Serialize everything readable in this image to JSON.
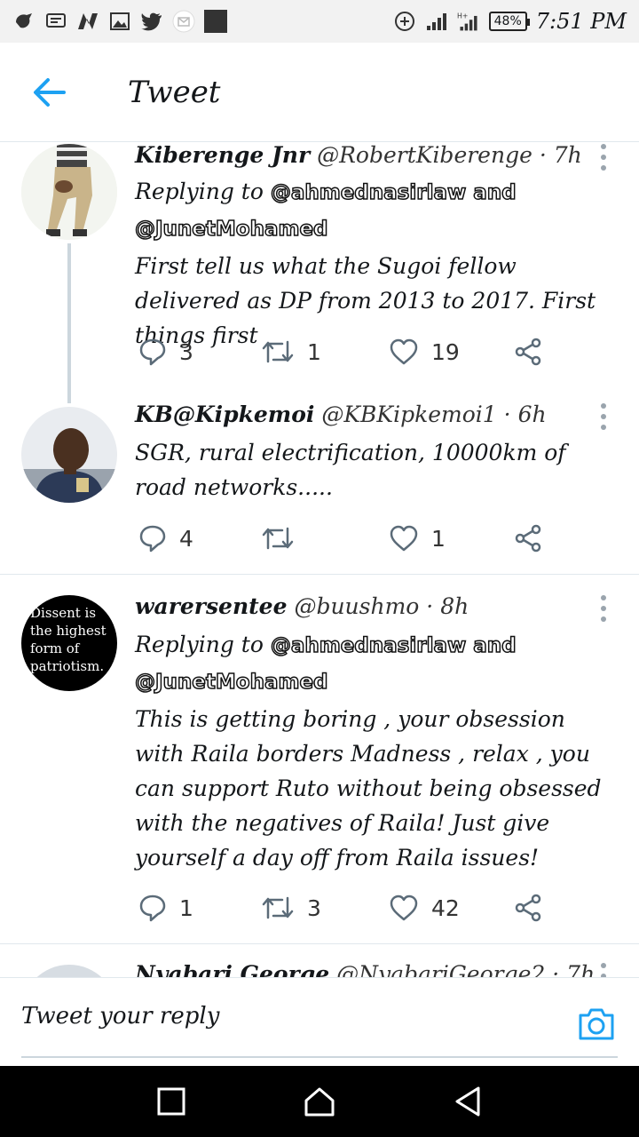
{
  "status_bar": {
    "battery": "48%",
    "time": "7:51 PM",
    "network": "H+"
  },
  "header": {
    "title": "Tweet"
  },
  "tweets": [
    {
      "name": "Kiberenge Jnr",
      "handle": "@RobertKiberenge",
      "time": "7h",
      "replying_label": "Replying to",
      "replying_to": "@ahmednasirlaw and @JunetMohamed",
      "text": "First tell us what the Sugoi fellow delivered as DP from 2013 to 2017. First things first",
      "replies": "3",
      "retweets": "1",
      "likes": "19"
    },
    {
      "name": "KB@Kipkemoi",
      "handle": "@KBKipkemoi1",
      "time": "6h",
      "text": "SGR, rural electrification, 10000km of road networks.....",
      "replies": "4",
      "retweets": "",
      "likes": "1"
    },
    {
      "name": "warersentee",
      "handle": "@buushmo",
      "time": "8h",
      "replying_label": "Replying to",
      "replying_to": "@ahmednasirlaw and @JunetMohamed",
      "text": "This is getting boring , your obsession with Raila borders Madness , relax , you can support Ruto without being obsessed with the negatives of Raila! Just give yourself a day off from Raila issues!",
      "avatar_text": "Dissent is the highest form of patriotism.",
      "replies": "1",
      "retweets": "3",
      "likes": "42"
    },
    {
      "name": "Nyabari George",
      "handle": "@NyabariGeorge2",
      "time": "7h"
    }
  ],
  "reply_bar": {
    "placeholder": "Tweet your reply"
  },
  "colors": {
    "accent": "#1da1f2",
    "divider": "#e1e8ed",
    "icon": "#5b6b78"
  },
  "icons": [
    "back-arrow-icon",
    "reply-icon",
    "retweet-icon",
    "like-icon",
    "share-icon",
    "more-icon",
    "camera-icon"
  ]
}
